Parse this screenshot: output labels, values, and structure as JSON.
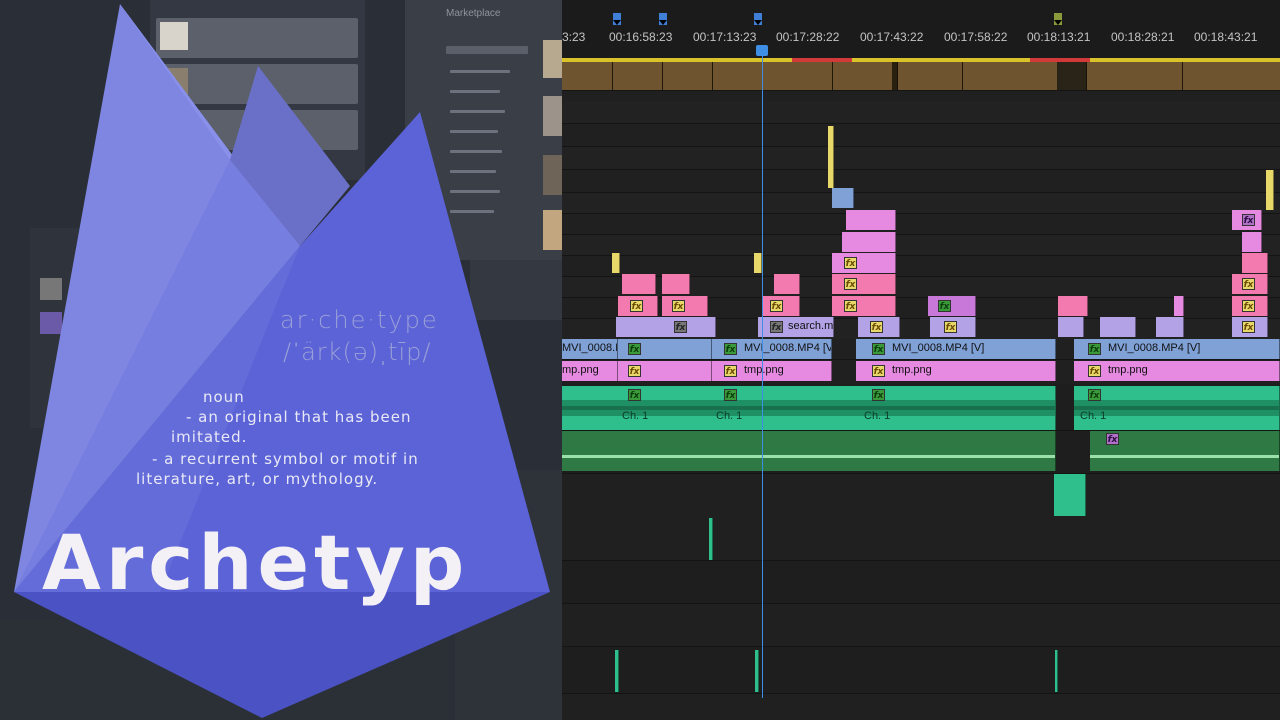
{
  "background_app": {
    "panel_title": "Marketplace"
  },
  "definition": {
    "word": "ar·che·type",
    "pronunciation": "/ˈärk(ə)ˌtīp/",
    "part_of_speech": "noun",
    "definition_1_line_1": "- an original that has been",
    "definition_1_line_2": "imitated.",
    "definition_2_line_1": "- a recurrent symbol or motif in",
    "definition_2_line_2": "literature, art, or mythology."
  },
  "brand": {
    "name": "Archetyp",
    "colors": {
      "primary": "#5b63d6",
      "light": "#8c93ec",
      "text": "#f4f1f6"
    }
  },
  "timeline": {
    "timecodes": [
      "3:23",
      "00:16:58:23",
      "00:17:13:23",
      "00:17:28:22",
      "00:17:43:22",
      "00:17:58:22",
      "00:18:13:21",
      "00:18:28:21",
      "00:18:43:21"
    ],
    "clip_labels": {
      "search": "search.m",
      "video_1": "MVI_0008.M",
      "video_2": "MVI_0008.MP4 [V",
      "video_3": "MVI_0008.MP4 [V]",
      "video_4": "MVI_0008.MP4 [V]",
      "image_1": "mp.png",
      "image_2": "tmp.png",
      "image_3": "tmp.png",
      "image_4": "tmp.png",
      "audio_ch": "Ch. 1"
    },
    "colors": {
      "video": "#7fa1d6",
      "image": "#e58ae0",
      "pink": "#f27aae",
      "lavender": "#b3a3e6",
      "audio": "#2fbf8c",
      "playhead": "#3f8ee6"
    }
  }
}
